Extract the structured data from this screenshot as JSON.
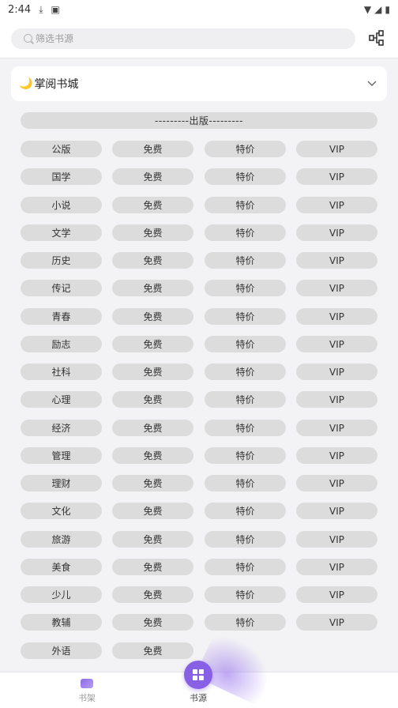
{
  "status": {
    "time": "2:44"
  },
  "search": {
    "placeholder": "筛选书源"
  },
  "source_card": {
    "title": "掌阅书城"
  },
  "section_header": "---------出版---------",
  "rows": [
    [
      "公版",
      "免费",
      "特价",
      "VIP"
    ],
    [
      "国学",
      "免费",
      "特价",
      "VIP"
    ],
    [
      "小说",
      "免费",
      "特价",
      "VIP"
    ],
    [
      "文学",
      "免费",
      "特价",
      "VIP"
    ],
    [
      "历史",
      "免费",
      "特价",
      "VIP"
    ],
    [
      "传记",
      "免费",
      "特价",
      "VIP"
    ],
    [
      "青春",
      "免费",
      "特价",
      "VIP"
    ],
    [
      "励志",
      "免费",
      "特价",
      "VIP"
    ],
    [
      "社科",
      "免费",
      "特价",
      "VIP"
    ],
    [
      "心理",
      "免费",
      "特价",
      "VIP"
    ],
    [
      "经济",
      "免费",
      "特价",
      "VIP"
    ],
    [
      "管理",
      "免费",
      "特价",
      "VIP"
    ],
    [
      "理财",
      "免费",
      "特价",
      "VIP"
    ],
    [
      "文化",
      "免费",
      "特价",
      "VIP"
    ],
    [
      "旅游",
      "免费",
      "特价",
      "VIP"
    ],
    [
      "美食",
      "免费",
      "特价",
      "VIP"
    ],
    [
      "少儿",
      "免费",
      "特价",
      "VIP"
    ],
    [
      "教辅",
      "免费",
      "特价",
      "VIP"
    ],
    [
      "外语",
      "免费"
    ]
  ],
  "bottom_nav": {
    "shelf": "书架",
    "source": "书源"
  },
  "colors": {
    "accent": "#8860e6",
    "pill": "#dcdcdc"
  }
}
